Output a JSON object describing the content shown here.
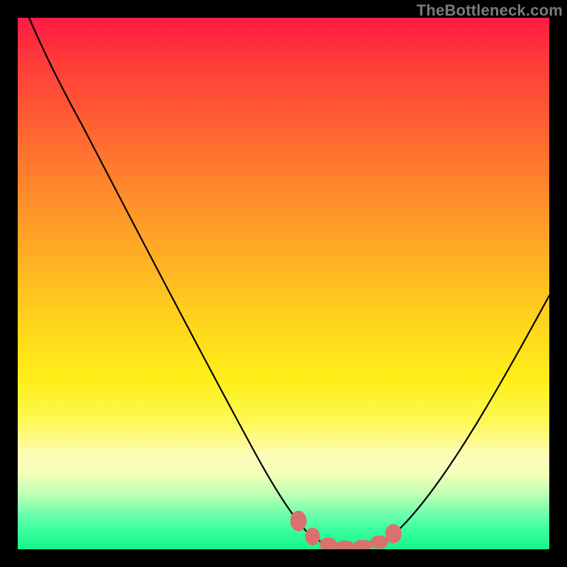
{
  "watermark": "TheBottleneck.com",
  "chart_data": {
    "type": "line",
    "title": "",
    "xlabel": "",
    "ylabel": "",
    "xlim": [
      0,
      100
    ],
    "ylim": [
      0,
      100
    ],
    "grid": false,
    "legend": false,
    "background_gradient": [
      "#ff1a44",
      "#ffee18",
      "#15f58a"
    ],
    "series": [
      {
        "name": "bottleneck-curve",
        "x": [
          0,
          5,
          10,
          15,
          20,
          25,
          30,
          35,
          40,
          45,
          50,
          53,
          56,
          59,
          62,
          65,
          68,
          72,
          76,
          80,
          84,
          88,
          92,
          96,
          100
        ],
        "y": [
          100,
          95,
          86,
          76,
          66,
          57,
          47,
          38,
          28,
          18,
          9,
          5,
          2,
          1,
          0,
          0,
          1,
          3,
          8,
          15,
          23,
          32,
          41,
          50,
          59
        ]
      }
    ],
    "markers": {
      "name": "highlighted-min-region",
      "x": [
        50,
        54,
        58,
        61,
        64,
        67,
        70
      ],
      "y": [
        5,
        1.5,
        0.5,
        0,
        0,
        0.5,
        2.5
      ]
    }
  }
}
